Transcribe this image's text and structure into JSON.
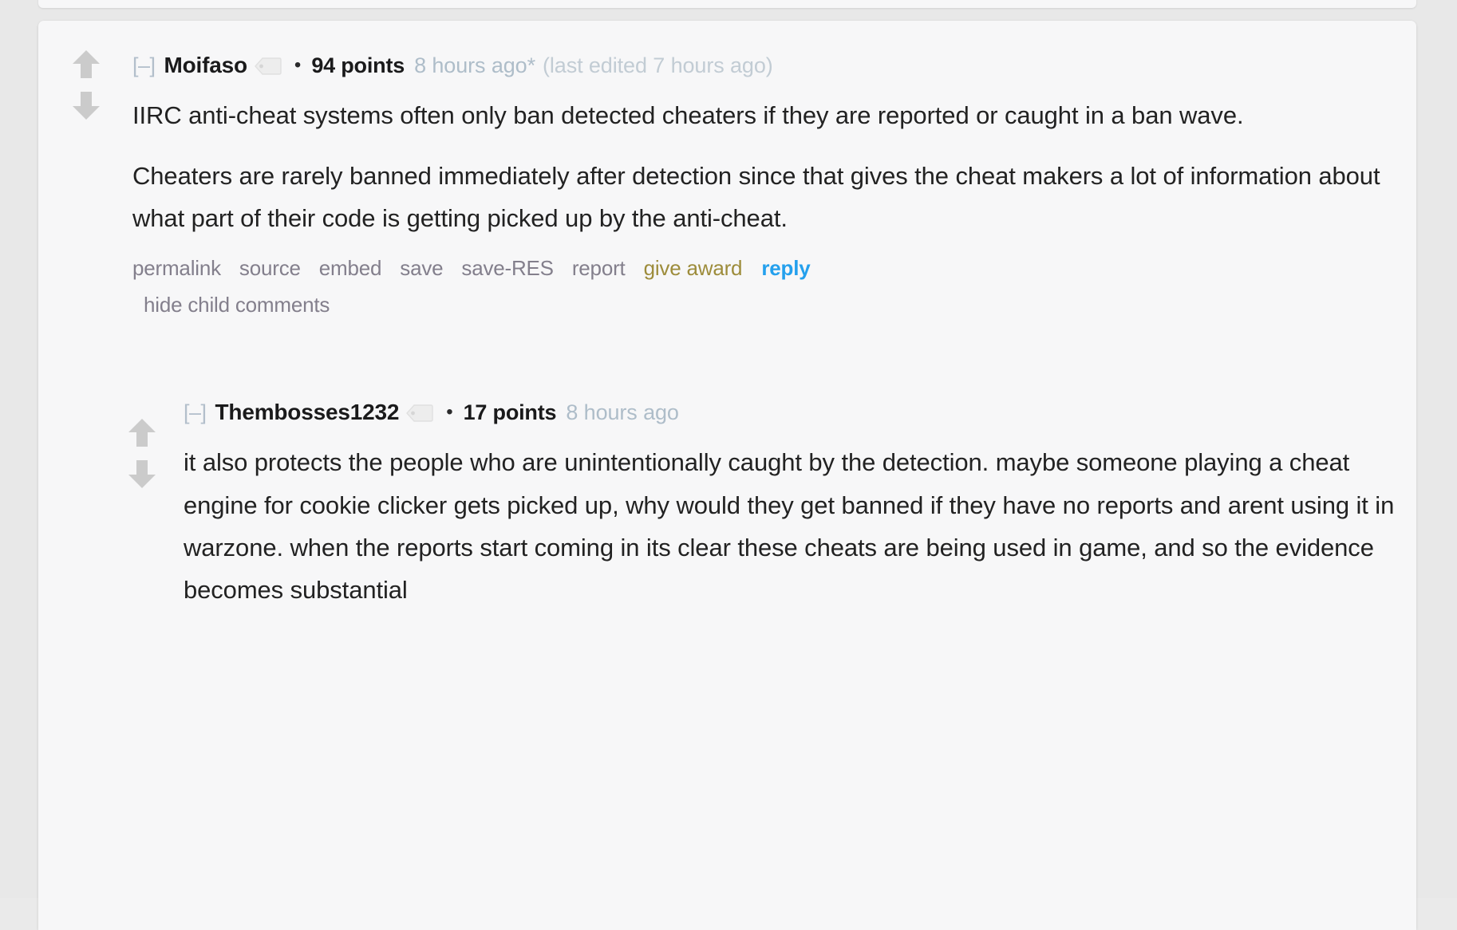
{
  "theme": {
    "page_background": "#e8e8e8",
    "card_background": "#f7f7f8",
    "text_color": "#222222",
    "meta_color": "#aebdc9",
    "link_color": "#837f8c",
    "reply_color": "#24a0ed",
    "award_color": "#9d8c3b",
    "arrow_color": "#cccccc"
  },
  "comments": [
    {
      "collapse_toggle": "[–]",
      "author": "Moifaso",
      "user_tag_icon": "tag-icon",
      "separator": "•",
      "points": "94 points",
      "timestamp": "8 hours ago*",
      "edited": "(last edited 7 hours ago)",
      "upvote_icon": "upvote-arrow-icon",
      "downvote_icon": "downvote-arrow-icon",
      "paragraphs": [
        "IIRC anti-cheat systems often only ban detected cheaters if they are reported or caught in a ban wave.",
        "Cheaters are rarely banned immediately after detection since that gives the cheat makers a lot of information about what part of their code is getting picked up by the anti-cheat."
      ],
      "actions": {
        "permalink": "permalink",
        "source": "source",
        "embed": "embed",
        "save": "save",
        "save_res": "save-RES",
        "report": "report",
        "give_award": "give award",
        "reply": "reply",
        "hide_child_comments": "hide child comments"
      }
    },
    {
      "collapse_toggle": "[–]",
      "author": "Thembosses1232",
      "user_tag_icon": "tag-icon",
      "separator": "•",
      "points": "17 points",
      "timestamp": "8 hours ago",
      "edited": "",
      "upvote_icon": "upvote-arrow-icon",
      "downvote_icon": "downvote-arrow-icon",
      "paragraphs": [
        "it also protects the people who are unintentionally caught by the detection. maybe someone playing a cheat engine for cookie clicker gets picked up, why would they get banned if they have no reports and arent using it in warzone. when the reports start coming in its clear these cheats are being used in game, and so the evidence becomes substantial"
      ]
    }
  ]
}
